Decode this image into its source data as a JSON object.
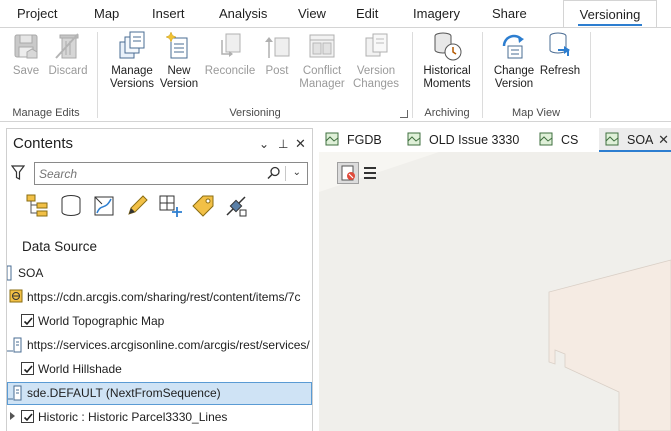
{
  "ribbon_tabs": [
    "Project",
    "Map",
    "Insert",
    "Analysis",
    "View",
    "Edit",
    "Imagery",
    "Share",
    "Versioning"
  ],
  "active_tab": "Versioning",
  "groups": {
    "manage_edits": {
      "label": "Manage Edits",
      "buttons": {
        "save": "Save",
        "discard": "Discard"
      }
    },
    "versioning": {
      "label": "Versioning",
      "buttons": {
        "manage_versions": [
          "Manage",
          "Versions"
        ],
        "new_version": [
          "New",
          "Version"
        ],
        "reconcile": "Reconcile",
        "post": "Post",
        "conflict_manager": [
          "Conflict",
          "Manager"
        ],
        "version_changes": [
          "Version",
          "Changes"
        ]
      }
    },
    "archiving": {
      "label": "Archiving",
      "buttons": {
        "historical_moments": [
          "Historical",
          "Moments"
        ]
      }
    },
    "map_view": {
      "label": "Map View",
      "buttons": {
        "change_version": [
          "Change",
          "Version"
        ],
        "refresh": "Refresh"
      }
    }
  },
  "contents": {
    "title": "Contents",
    "controls": {
      "menu": "⌄",
      "pin": "⊥",
      "close": "✕"
    },
    "search": {
      "placeholder": "Search",
      "value": ""
    },
    "view_icons": [
      "list-by-drawing-order",
      "list-by-data-source",
      "list-by-selection",
      "list-by-editing",
      "list-by-snapping",
      "list-by-labeling",
      "list-by-perspective-imagery"
    ],
    "section_heading": "Data Source",
    "tree": [
      {
        "label": "SOA",
        "kind": "map"
      },
      {
        "label": "https://cdn.arcgis.com/sharing/rest/content/items/7c",
        "kind": "source"
      },
      {
        "label": "World Topographic Map",
        "kind": "layer",
        "checked": true
      },
      {
        "label": "https://services.arcgisonline.com/arcgis/rest/services/",
        "kind": "source"
      },
      {
        "label": "World Hillshade",
        "kind": "layer",
        "checked": true
      },
      {
        "label": "sde.DEFAULT (NextFromSequence)",
        "kind": "source",
        "selected": true
      },
      {
        "label": "Historic : Historic Parcel3330_Lines",
        "kind": "layer",
        "checked": true,
        "expandable": true
      }
    ]
  },
  "map_tabs": [
    {
      "label": "FGDB",
      "active": false
    },
    {
      "label": "OLD Issue 3330",
      "active": false
    },
    {
      "label": "CS",
      "active": false
    },
    {
      "label": "SOA",
      "active": true
    }
  ],
  "colors": {
    "accent": "#2d7ed0",
    "selection_fill": "#cfe3f5",
    "map_background": "#f0efeb",
    "map_parcel": "#f5ebe3"
  }
}
